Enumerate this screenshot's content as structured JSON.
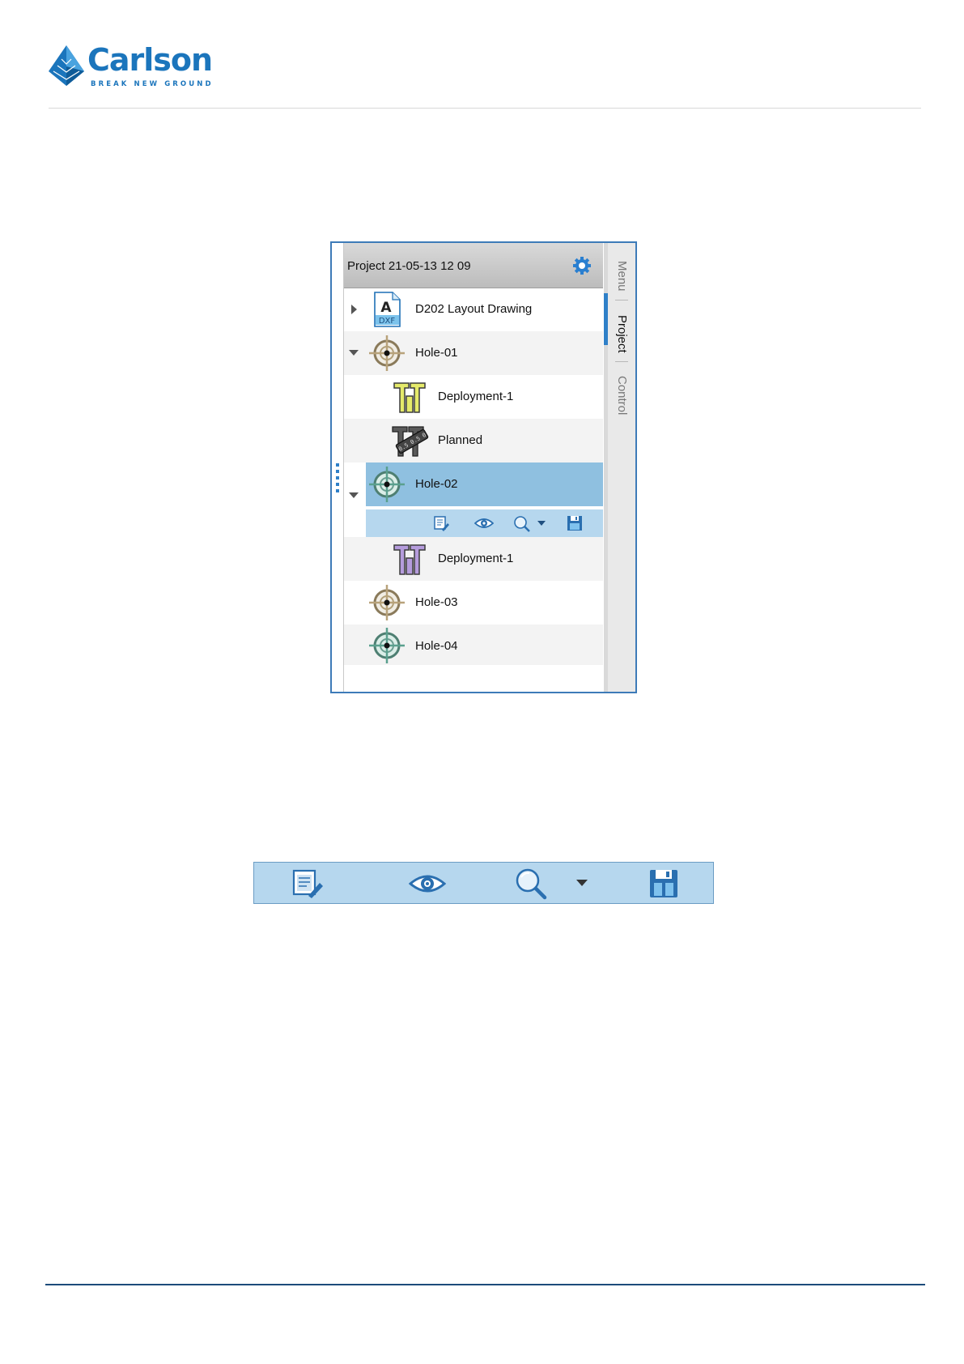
{
  "logo": {
    "wordmark": "Carlson",
    "tagline": "BREAK NEW GROUND",
    "brand_color": "#1b75bc"
  },
  "panel": {
    "project_title": "Project 21-05-13 12 09",
    "settings_icon": "gear-icon",
    "side_tabs": [
      "Menu",
      "Project",
      "Control"
    ],
    "active_tab": "Project",
    "tree": [
      {
        "label": "D202 Layout Drawing",
        "icon": "dxf-file-icon",
        "expander": "collapsed"
      },
      {
        "label": "Hole-01",
        "icon": "hole-target-icon",
        "expander": "expanded"
      },
      {
        "label": "Deployment-1",
        "icon": "deployment-icon"
      },
      {
        "label": "Planned",
        "icon": "planned-deployment-icon"
      },
      {
        "label": "Hole-02",
        "icon": "hole-target-icon",
        "expander": "expanded",
        "selected": true
      },
      {
        "label": "Deployment-1",
        "icon": "deployment-icon"
      },
      {
        "label": "Hole-03",
        "icon": "hole-target-icon"
      },
      {
        "label": "Hole-04",
        "icon": "hole-target-icon"
      }
    ],
    "selection_color": "#8fc0e0",
    "action_icons": [
      "edit-icon",
      "visibility-eye-icon",
      "zoom-icon",
      "dropdown-arrow-icon",
      "save-icon"
    ]
  },
  "toolbar": {
    "icons": [
      "edit-icon",
      "visibility-eye-icon",
      "zoom-icon",
      "dropdown-arrow-icon",
      "save-icon"
    ],
    "background": "#b6d7ee"
  }
}
